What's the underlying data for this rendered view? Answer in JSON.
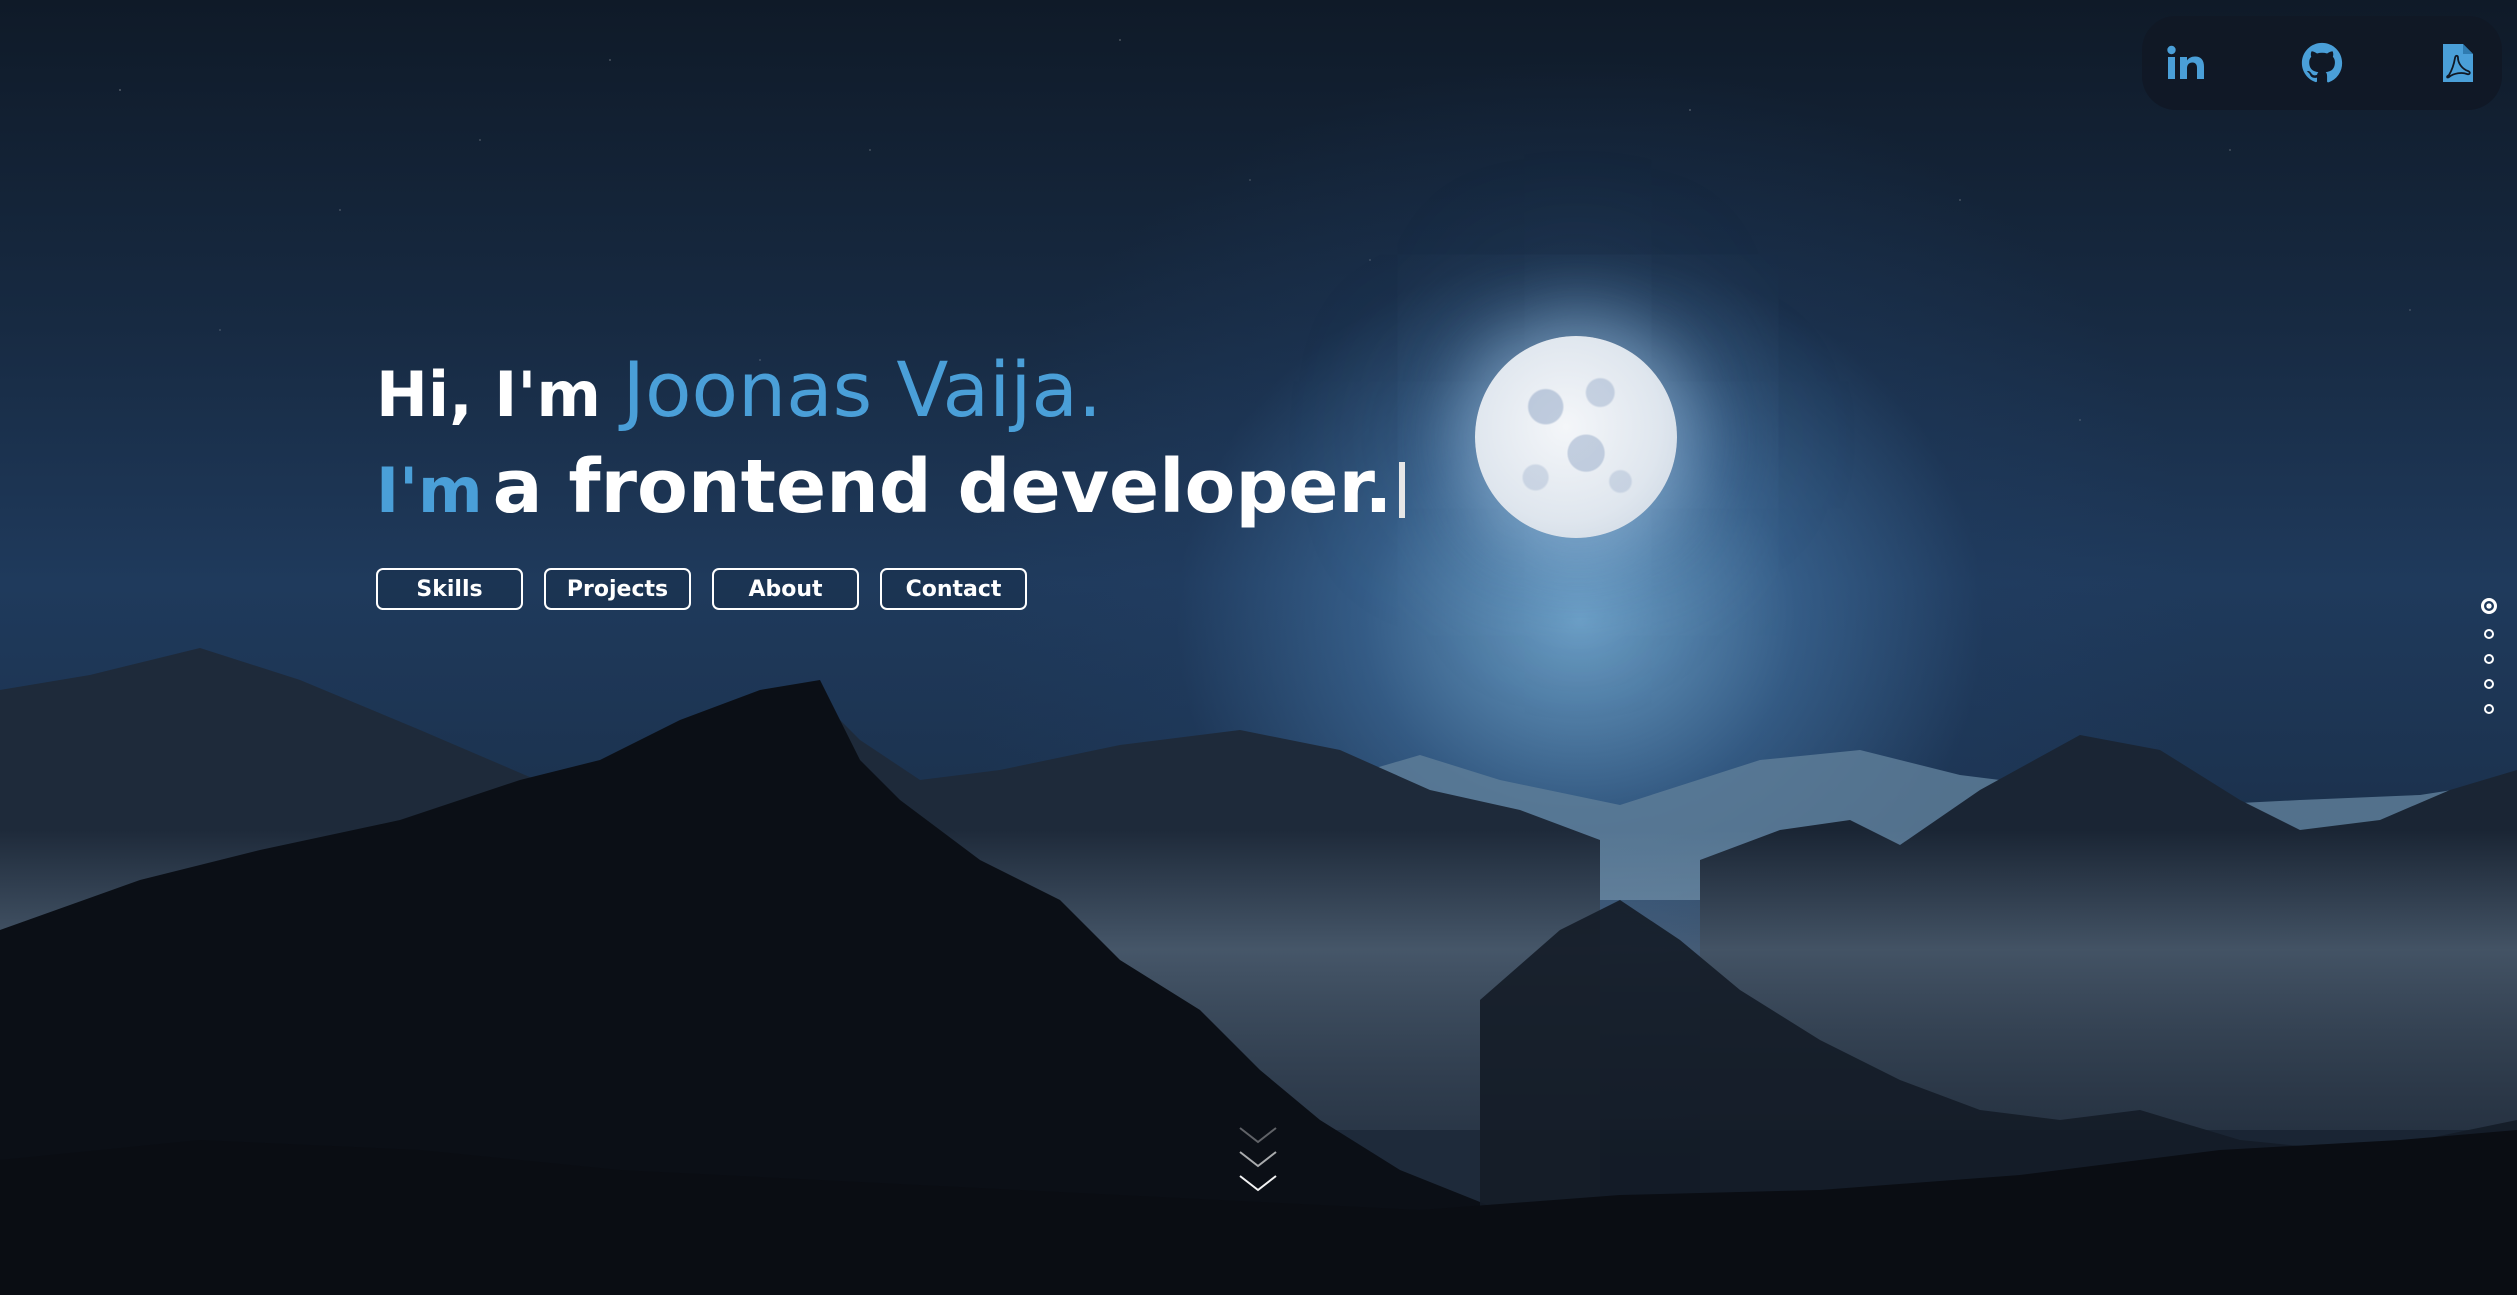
{
  "hero": {
    "greeting": "Hi, I'm",
    "name": "Joonas Vaija.",
    "im": "I'm",
    "role": "a frontend developer."
  },
  "nav": {
    "items": [
      {
        "label": "Skills"
      },
      {
        "label": "Projects"
      },
      {
        "label": "About"
      },
      {
        "label": "Contact"
      }
    ]
  },
  "social": {
    "icons": [
      "linkedin-icon",
      "github-icon",
      "pdf-resume-icon"
    ],
    "linkedin_text": "in"
  },
  "section_dots": {
    "count": 5,
    "active_index": 0
  },
  "scroll_hint": {
    "icon": "scroll-down-chevrons-icon"
  },
  "colors": {
    "accent": "#4a9fd8",
    "text": "#ffffff",
    "social_bg": "#101824"
  }
}
